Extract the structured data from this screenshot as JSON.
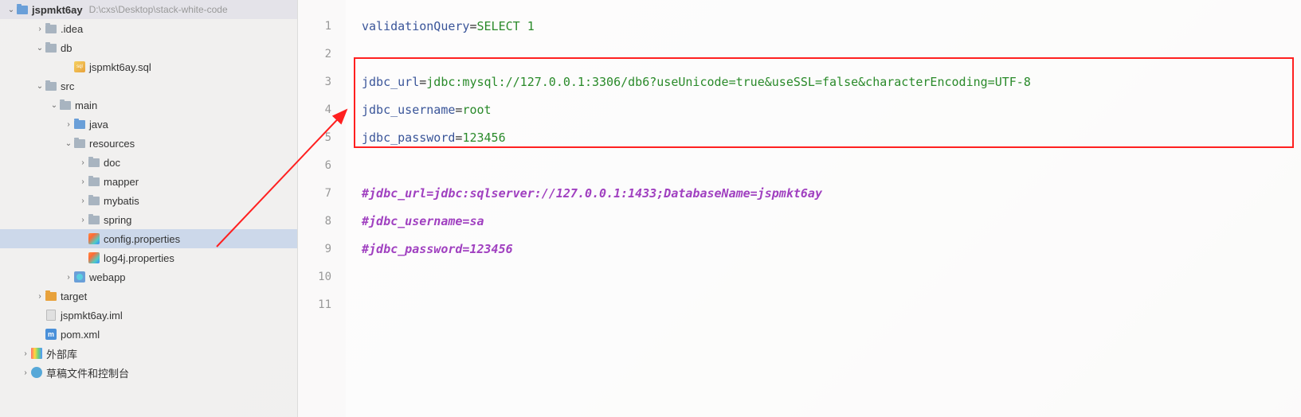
{
  "sidebar": {
    "project_root": "jspmkt6ay",
    "project_path": "D:\\cxs\\Desktop\\stack-white-code",
    "nodes": [
      {
        "label": ".idea",
        "indent": 2,
        "icon": "folder",
        "chevron": ">"
      },
      {
        "label": "db",
        "indent": 2,
        "icon": "folder",
        "chevron": "v"
      },
      {
        "label": "jspmkt6ay.sql",
        "indent": 4,
        "icon": "sql",
        "chevron": ""
      },
      {
        "label": "src",
        "indent": 2,
        "icon": "folder",
        "chevron": "v"
      },
      {
        "label": "main",
        "indent": 3,
        "icon": "folder",
        "chevron": "v"
      },
      {
        "label": "java",
        "indent": 4,
        "icon": "folder-blue",
        "chevron": ">"
      },
      {
        "label": "resources",
        "indent": 4,
        "icon": "folder",
        "chevron": "v"
      },
      {
        "label": "doc",
        "indent": 5,
        "icon": "folder",
        "chevron": ">"
      },
      {
        "label": "mapper",
        "indent": 5,
        "icon": "folder",
        "chevron": ">"
      },
      {
        "label": "mybatis",
        "indent": 5,
        "icon": "folder",
        "chevron": ">"
      },
      {
        "label": "spring",
        "indent": 5,
        "icon": "folder",
        "chevron": ">"
      },
      {
        "label": "config.properties",
        "indent": 5,
        "icon": "prop",
        "chevron": "",
        "selected": true
      },
      {
        "label": "log4j.properties",
        "indent": 5,
        "icon": "prop",
        "chevron": ""
      },
      {
        "label": "webapp",
        "indent": 4,
        "icon": "webapp",
        "chevron": ">"
      },
      {
        "label": "target",
        "indent": 2,
        "icon": "folder-orange",
        "chevron": ">"
      },
      {
        "label": "jspmkt6ay.iml",
        "indent": 2,
        "icon": "file",
        "chevron": ""
      },
      {
        "label": "pom.xml",
        "indent": 2,
        "icon": "maven",
        "chevron": ""
      },
      {
        "label": "外部库",
        "indent": 1,
        "icon": "lib",
        "chevron": ">"
      },
      {
        "label": "草稿文件和控制台",
        "indent": 1,
        "icon": "scratch",
        "chevron": ">"
      }
    ]
  },
  "editor": {
    "line_numbers": [
      "1",
      "2",
      "3",
      "4",
      "5",
      "6",
      "7",
      "8",
      "9",
      "10",
      "11"
    ],
    "lines": {
      "l1": {
        "key": "validationQuery",
        "val": "SELECT 1"
      },
      "l3": {
        "key": "jdbc_url",
        "val": "jdbc:mysql://127.0.0.1:3306/db6?useUnicode=true&useSSL=false&characterEncoding=UTF-8"
      },
      "l4": {
        "key": "jdbc_username",
        "val": "root"
      },
      "l5": {
        "key": "jdbc_password",
        "val": "123456"
      },
      "l7": {
        "comment": "#jdbc_url=jdbc:sqlserver://127.0.0.1:1433;DatabaseName=jspmkt6ay"
      },
      "l8": {
        "comment": "#jdbc_username=sa"
      },
      "l9": {
        "comment": "#jdbc_password=123456"
      }
    }
  }
}
